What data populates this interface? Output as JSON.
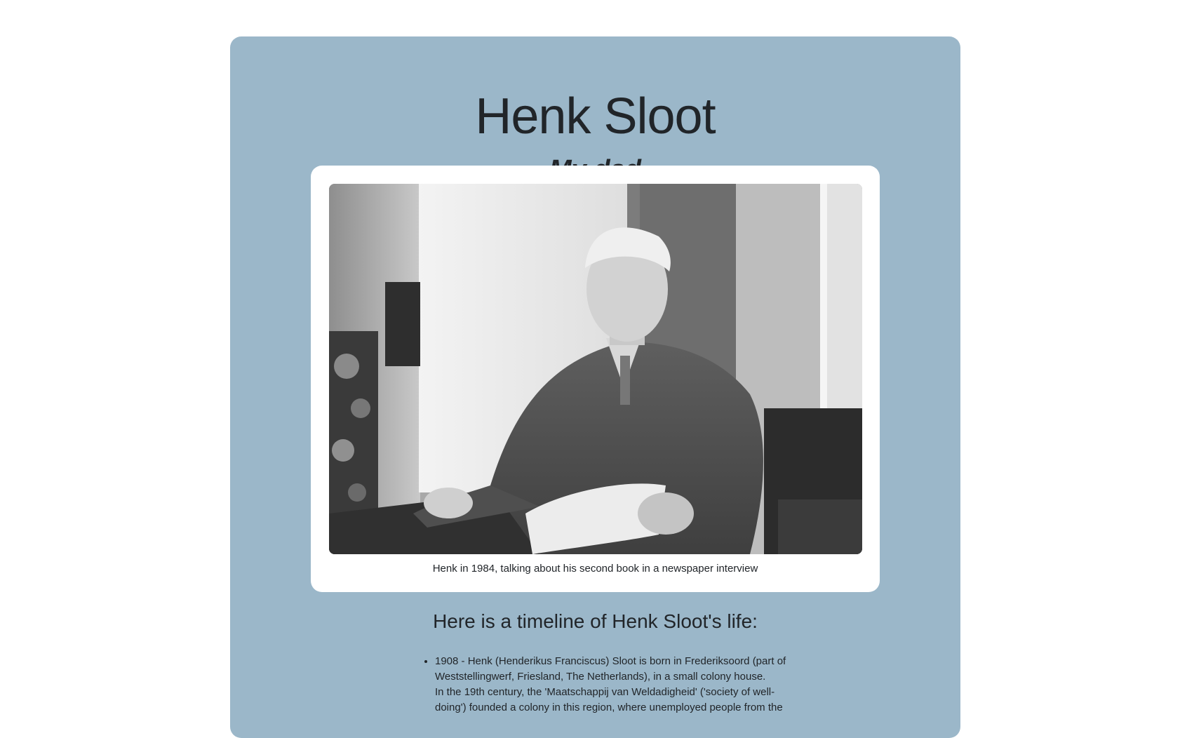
{
  "page": {
    "title": "Henk Sloot",
    "subtitle": "My dad"
  },
  "photo": {
    "caption": "Henk in 1984, talking about his second book in a newspaper interview"
  },
  "timeline": {
    "heading": "Here is a timeline of Henk Sloot's life:",
    "items": [
      {
        "line1": "1908 - Henk (Henderikus Franciscus) Sloot is born in Frederiksoord (part of Weststellingwerf, Friesland, The Netherlands), in a small colony house.",
        "line2": "In the 19th century, the 'Maatschappij van Weldadigheid' ('society of well-doing') founded a colony in this region, where unemployed people from the"
      }
    ]
  },
  "colors": {
    "panel": "#9bb7c9",
    "card": "#ffffff",
    "text": "#212529"
  }
}
